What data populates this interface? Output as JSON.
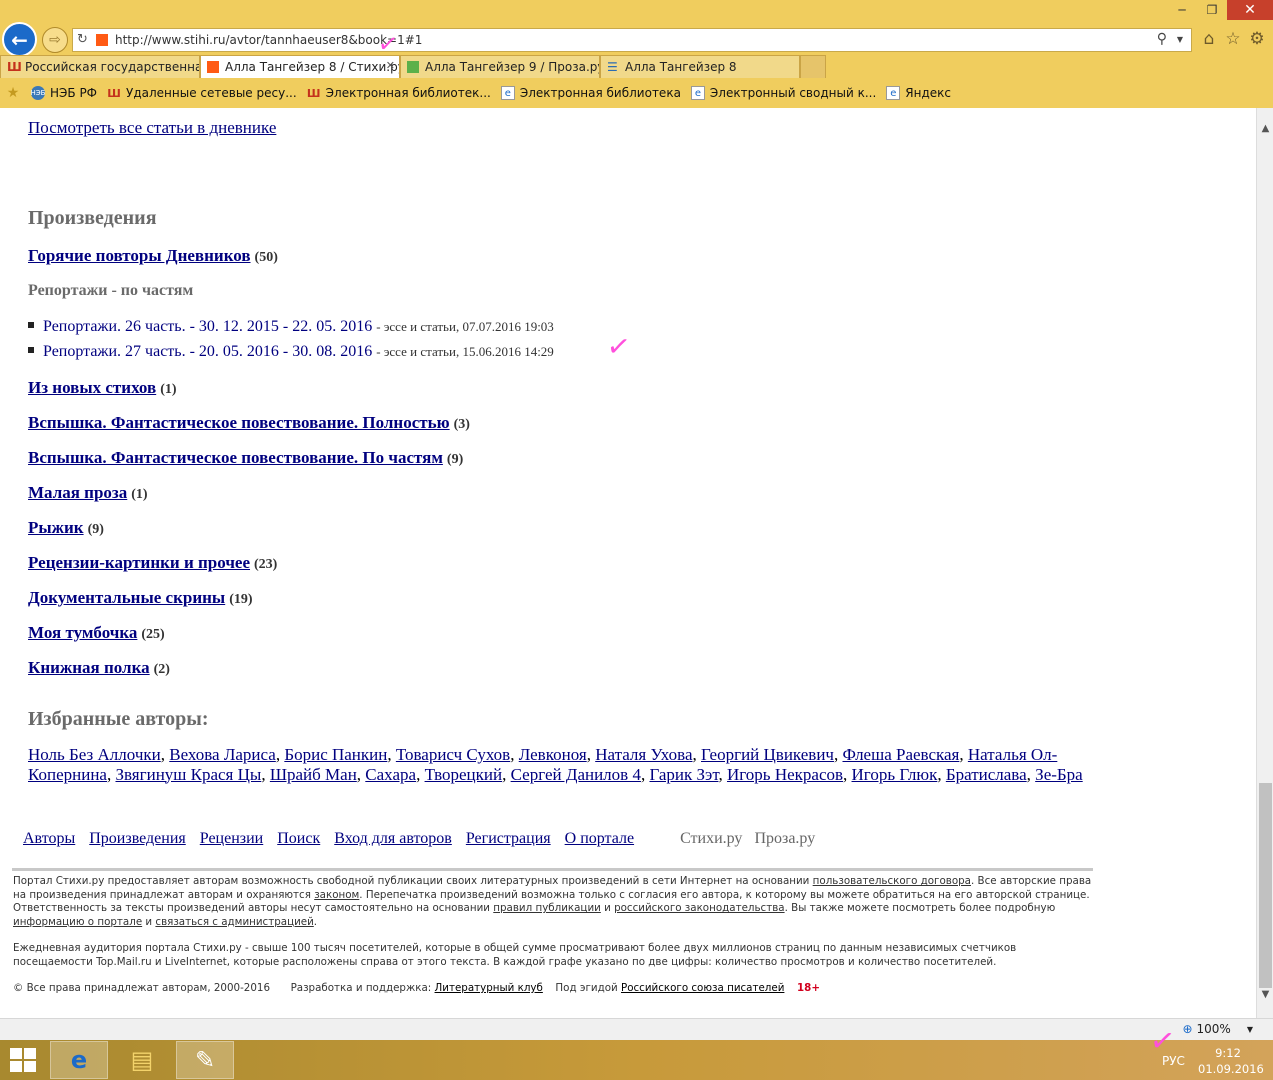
{
  "browser": {
    "address_url": "http://www.stihi.ru/avtor/tannhaeuser8&book=1#1",
    "window_buttons": [
      "─",
      "❐",
      "✕"
    ],
    "tabs": [
      {
        "label": "Российская государственная ...",
        "icon": "rgb-library-icon",
        "color": "#c4311c",
        "active": false
      },
      {
        "label": "Алла Тангейзер 8 / Стихи.ру",
        "icon": "stihi-icon",
        "color": "#ff5a14",
        "active": true
      },
      {
        "label": "Алла Тангейзер 9 / Проза.ру",
        "icon": "proza-icon",
        "color": "#5cb04a",
        "active": false
      },
      {
        "label": "Алла Тангейзер 8",
        "icon": "book-icon",
        "color": "#2b6cb3",
        "active": false
      }
    ],
    "favorites": [
      {
        "label": "НЭБ РФ",
        "icon": "neb-icon"
      },
      {
        "label": "Удаленные сетевые ресу...",
        "icon": "rgb-library-icon"
      },
      {
        "label": "Электронная библиотек...",
        "icon": "rgb-library-icon"
      },
      {
        "label": "Электронная библиотека",
        "icon": "ie-page-icon"
      },
      {
        "label": "Электронный сводный к...",
        "icon": "ie-page-icon"
      },
      {
        "label": "Яндекс",
        "icon": "ie-page-icon"
      }
    ]
  },
  "page": {
    "diary_link": "Посмотреть все статьи в дневнике",
    "works_heading": "Произведения",
    "books": [
      {
        "title": "Горячие повторы Дневников",
        "count": "(50)"
      }
    ],
    "reports_heading": "Репортажи - по частям",
    "reports": [
      {
        "title": "Репортажи. 26 часть. - 30. 12. 2015 - 22. 05. 2016",
        "meta": "- эссе и статьи, 07.07.2016 19:03"
      },
      {
        "title": "Репортажи. 27 часть. - 20. 05. 2016 - 30. 08. 2016",
        "meta": "- эссе и статьи, 15.06.2016 14:29"
      }
    ],
    "more_books": [
      {
        "title": "Из новых стихов",
        "count": "(1)"
      },
      {
        "title": "Вспышка. Фантастическое повествование. Полностью",
        "count": "(3)"
      },
      {
        "title": "Вспышка. Фантастическое повествование. По частям",
        "count": "(9)"
      },
      {
        "title": "Малая проза",
        "count": "(1)"
      },
      {
        "title": "Рыжик",
        "count": "(9)"
      },
      {
        "title": "Рецензии-картинки и прочее",
        "count": "(23)"
      },
      {
        "title": "Документальные скрины",
        "count": "(19)"
      },
      {
        "title": "Моя тумбочка",
        "count": "(25)"
      },
      {
        "title": "Книжная полка",
        "count": "(2)"
      }
    ],
    "authors_heading": "Избранные авторы:",
    "authors": [
      "Ноль Без Аллочки",
      "Вехова Лариса",
      "Борис Панкин",
      "Товарисч Сухов",
      "Левконоя",
      "Наталя Ухова",
      "Георгий Цвикевич",
      "Флеша Раевская",
      "Наталья Ол-Копернина",
      "Звягинуш Крася Цы",
      "Шрайб Ман",
      "Сахара",
      "Творецкий",
      "Сергей Данилов 4",
      "Гарик Зэт",
      "Игорь Некрасов",
      "Игорь Глюк",
      "Братислава",
      "Зе-Бра"
    ],
    "footer_nav": [
      "Авторы",
      "Произведения",
      "Рецензии",
      "Поиск",
      "Вход для авторов",
      "Регистрация",
      "О портале"
    ],
    "footer_sites": [
      "Стихи.ру",
      "Проза.ру"
    ],
    "footer_text_1": {
      "a": "Портал Стихи.ру предоставляет авторам возможность свободной публикации своих литературных произведений в сети Интернет на основании ",
      "l1": "пользовательского договора",
      "b": ". Все авторские права на произведения принадлежат авторам и охраняются ",
      "l2": "законом",
      "c": ". Перепечатка произведений возможна только с согласия его автора, к которому вы можете обратиться на его авторской странице. Ответственность за тексты произведений авторы несут самостоятельно на основании ",
      "l3": "правил публикации",
      "d": " и ",
      "l4": "российского законодательства",
      "e": ". Вы также можете посмотреть более подробную ",
      "l5": "информацию о портале",
      "f": " и ",
      "l6": "связаться с администрацией",
      "g": "."
    },
    "footer_text_2": "Ежедневная аудитория портала Стихи.ру - свыше 100 тысяч посетителей, которые в общей сумме просматривают более двух миллионов страниц по данным независимых счетчиков посещаемости Top.Mail.ru и LiveInternet, которые расположены справа от этого текста. В каждой графе указано по две цифры: количество просмотров и количество посетителей.",
    "copyright": "© Все права принадлежат авторам, 2000-2016",
    "dev_label": "Разработка и поддержка:",
    "dev_link": "Литературный клуб",
    "aegis_label": "Под эгидой",
    "aegis_link": "Российского союза писателей",
    "age": "18+"
  },
  "statusbar": {
    "zoom": "100%"
  },
  "taskbar": {
    "lang": "РУС",
    "time": "9:12",
    "date": "01.09.2016"
  },
  "colors": {
    "link": "#00007f",
    "heading": "#6a6a6a",
    "chrome": "#f0cd5e",
    "annotation": "#ff50dc"
  }
}
